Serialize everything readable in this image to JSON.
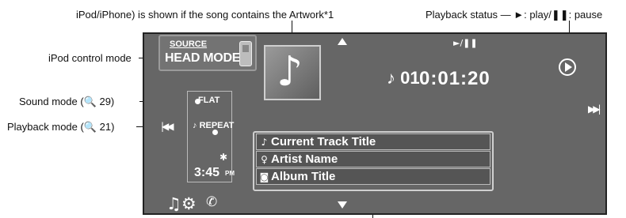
{
  "callouts": {
    "artwork": "iPod/iPhone) is shown if the song contains the Artwork*1",
    "playback_status": "Playback status — ►: play/❚❚: pause",
    "ipod_control_mode": "iPod control mode",
    "sound_mode": "Sound mode (🔍 29)",
    "playback_mode": "Playback mode (🔍 21)"
  },
  "screen": {
    "source_label": "SOURCE",
    "head_mode": "HEAD MODE",
    "play_pause_glyph": "►/❚❚",
    "track_note": "♪",
    "track_number": "01",
    "elapsed_time": "0:01:20",
    "sound_mode_value": "FLAT",
    "repeat_label": "REPEAT",
    "repeat_note": "♪",
    "bluetooth_glyph": "✱",
    "clock_time": "3:45",
    "clock_ampm": "PM",
    "prev_glyph": "|◀◀",
    "next_glyph": "▶▶|",
    "track_list": [
      {
        "icon": "♪",
        "text": "Current Track Title"
      },
      {
        "icon": "♀",
        "text": "Artist Name"
      },
      {
        "icon": "◙",
        "text": "Album Title"
      }
    ],
    "bottom_icons": {
      "music_settings": "♫⚙",
      "phone": "✆"
    }
  },
  "colors": {
    "screen_bg": "#666666",
    "text": "#ffffff",
    "row_bg": "#555555"
  }
}
